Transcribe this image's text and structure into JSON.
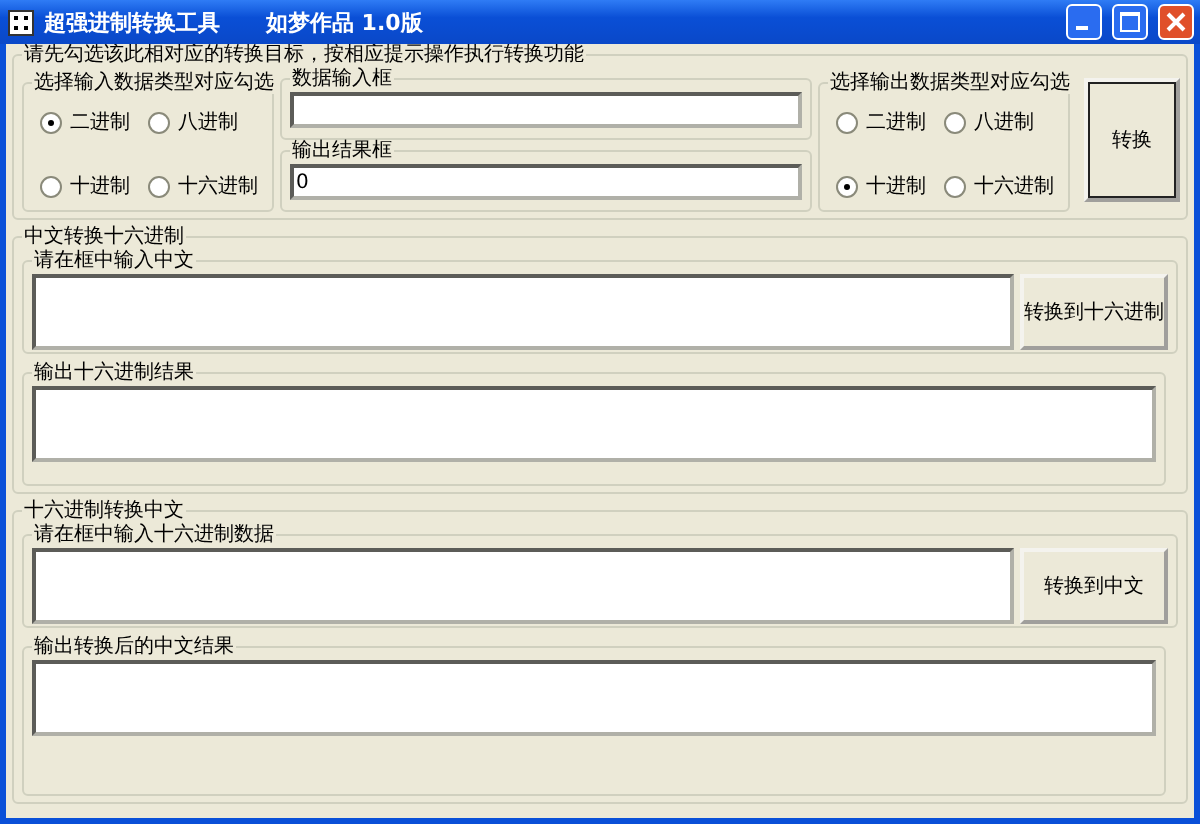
{
  "window": {
    "title": "超强进制转换工具      如梦作品 1.0版"
  },
  "instructions": "请先勾选该此相对应的转换目标，按相应提示操作执行转换功能",
  "input_type": {
    "label": "选择输入数据类型对应勾选",
    "options": [
      {
        "label": "二进制",
        "selected": true
      },
      {
        "label": "八进制",
        "selected": false
      },
      {
        "label": "十进制",
        "selected": false
      },
      {
        "label": "十六进制",
        "selected": false
      }
    ]
  },
  "data_input": {
    "label": "数据输入框"
  },
  "output_result": {
    "label": "输出结果框",
    "value": "0"
  },
  "output_type": {
    "label": "选择输出数据类型对应勾选",
    "options": [
      {
        "label": "二进制",
        "selected": false
      },
      {
        "label": "八进制",
        "selected": false
      },
      {
        "label": "十进制",
        "selected": true
      },
      {
        "label": "十六进制",
        "selected": false
      }
    ]
  },
  "convert_button": "转换",
  "cn_to_hex": {
    "title": "中文转换十六进制",
    "input_label": "请在框中输入中文",
    "button": "转换到十六进制",
    "output_label": "输出十六进制结果"
  },
  "hex_to_cn": {
    "title": "十六进制转换中文",
    "input_label": "请在框中输入十六进制数据",
    "button": "转换到中文",
    "output_label": "输出转换后的中文结果"
  }
}
